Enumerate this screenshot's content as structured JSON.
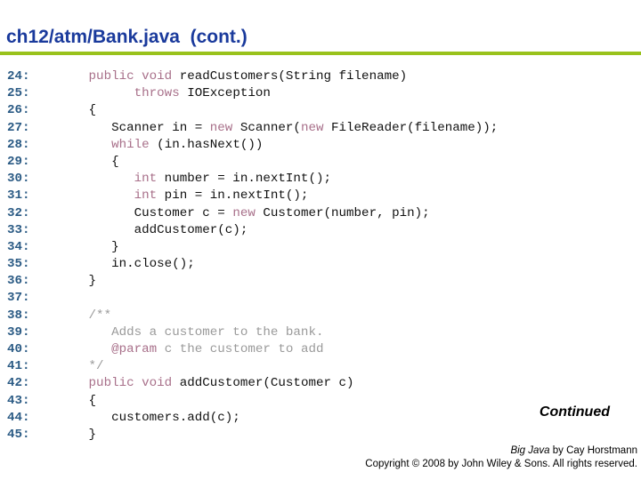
{
  "slide": {
    "title": "ch12/atm/Bank.java  (cont.)",
    "accent_color": "#99c21c",
    "title_color": "#1a3a9c"
  },
  "code": {
    "lines": [
      {
        "num": "24:",
        "segments": [
          {
            "t": "   "
          },
          {
            "t": "public void",
            "k": "kw"
          },
          {
            "t": " readCustomers(String filename)"
          }
        ]
      },
      {
        "num": "25:",
        "segments": [
          {
            "t": "         "
          },
          {
            "t": "throws",
            "k": "kw"
          },
          {
            "t": " IOException"
          }
        ]
      },
      {
        "num": "26:",
        "segments": [
          {
            "t": "   {"
          }
        ]
      },
      {
        "num": "27:",
        "segments": [
          {
            "t": "      Scanner in = "
          },
          {
            "t": "new",
            "k": "kw"
          },
          {
            "t": " Scanner("
          },
          {
            "t": "new",
            "k": "kw"
          },
          {
            "t": " FileReader(filename));"
          }
        ]
      },
      {
        "num": "28:",
        "segments": [
          {
            "t": "      "
          },
          {
            "t": "while",
            "k": "kw"
          },
          {
            "t": " (in.hasNext())"
          }
        ]
      },
      {
        "num": "29:",
        "segments": [
          {
            "t": "      {"
          }
        ]
      },
      {
        "num": "30:",
        "segments": [
          {
            "t": "         "
          },
          {
            "t": "int",
            "k": "kw"
          },
          {
            "t": " number = in.nextInt();"
          }
        ]
      },
      {
        "num": "31:",
        "segments": [
          {
            "t": "         "
          },
          {
            "t": "int",
            "k": "kw"
          },
          {
            "t": " pin = in.nextInt();"
          }
        ]
      },
      {
        "num": "32:",
        "segments": [
          {
            "t": "         Customer c = "
          },
          {
            "t": "new",
            "k": "kw"
          },
          {
            "t": " Customer(number, pin);"
          }
        ]
      },
      {
        "num": "33:",
        "segments": [
          {
            "t": "         addCustomer(c);"
          }
        ]
      },
      {
        "num": "34:",
        "segments": [
          {
            "t": "      }"
          }
        ]
      },
      {
        "num": "35:",
        "segments": [
          {
            "t": "      in.close();"
          }
        ]
      },
      {
        "num": "36:",
        "segments": [
          {
            "t": "   }"
          }
        ]
      },
      {
        "num": "37:",
        "segments": [
          {
            "t": ""
          }
        ]
      },
      {
        "num": "38:",
        "segments": [
          {
            "t": "   /**",
            "k": "cm"
          }
        ]
      },
      {
        "num": "39:",
        "segments": [
          {
            "t": "      Adds a customer to the bank.",
            "k": "cm"
          }
        ]
      },
      {
        "num": "40:",
        "segments": [
          {
            "t": "      ",
            "k": "cm"
          },
          {
            "t": "@param",
            "k": "kw"
          },
          {
            "t": " c the customer to add",
            "k": "cm"
          }
        ]
      },
      {
        "num": "41:",
        "segments": [
          {
            "t": "   */",
            "k": "cm"
          }
        ]
      },
      {
        "num": "42:",
        "segments": [
          {
            "t": "   "
          },
          {
            "t": "public void",
            "k": "kw"
          },
          {
            "t": " addCustomer(Customer c)"
          }
        ]
      },
      {
        "num": "43:",
        "segments": [
          {
            "t": "   {"
          }
        ]
      },
      {
        "num": "44:",
        "segments": [
          {
            "t": "      customers.add(c);"
          }
        ]
      },
      {
        "num": "45:",
        "segments": [
          {
            "t": "   }"
          }
        ]
      }
    ]
  },
  "continued_label": "Continued",
  "credit": {
    "book_title": "Big Java",
    "author_text": " by Cay Horstmann",
    "copyright": "Copyright © 2008 by John Wiley & Sons.  All rights reserved."
  }
}
